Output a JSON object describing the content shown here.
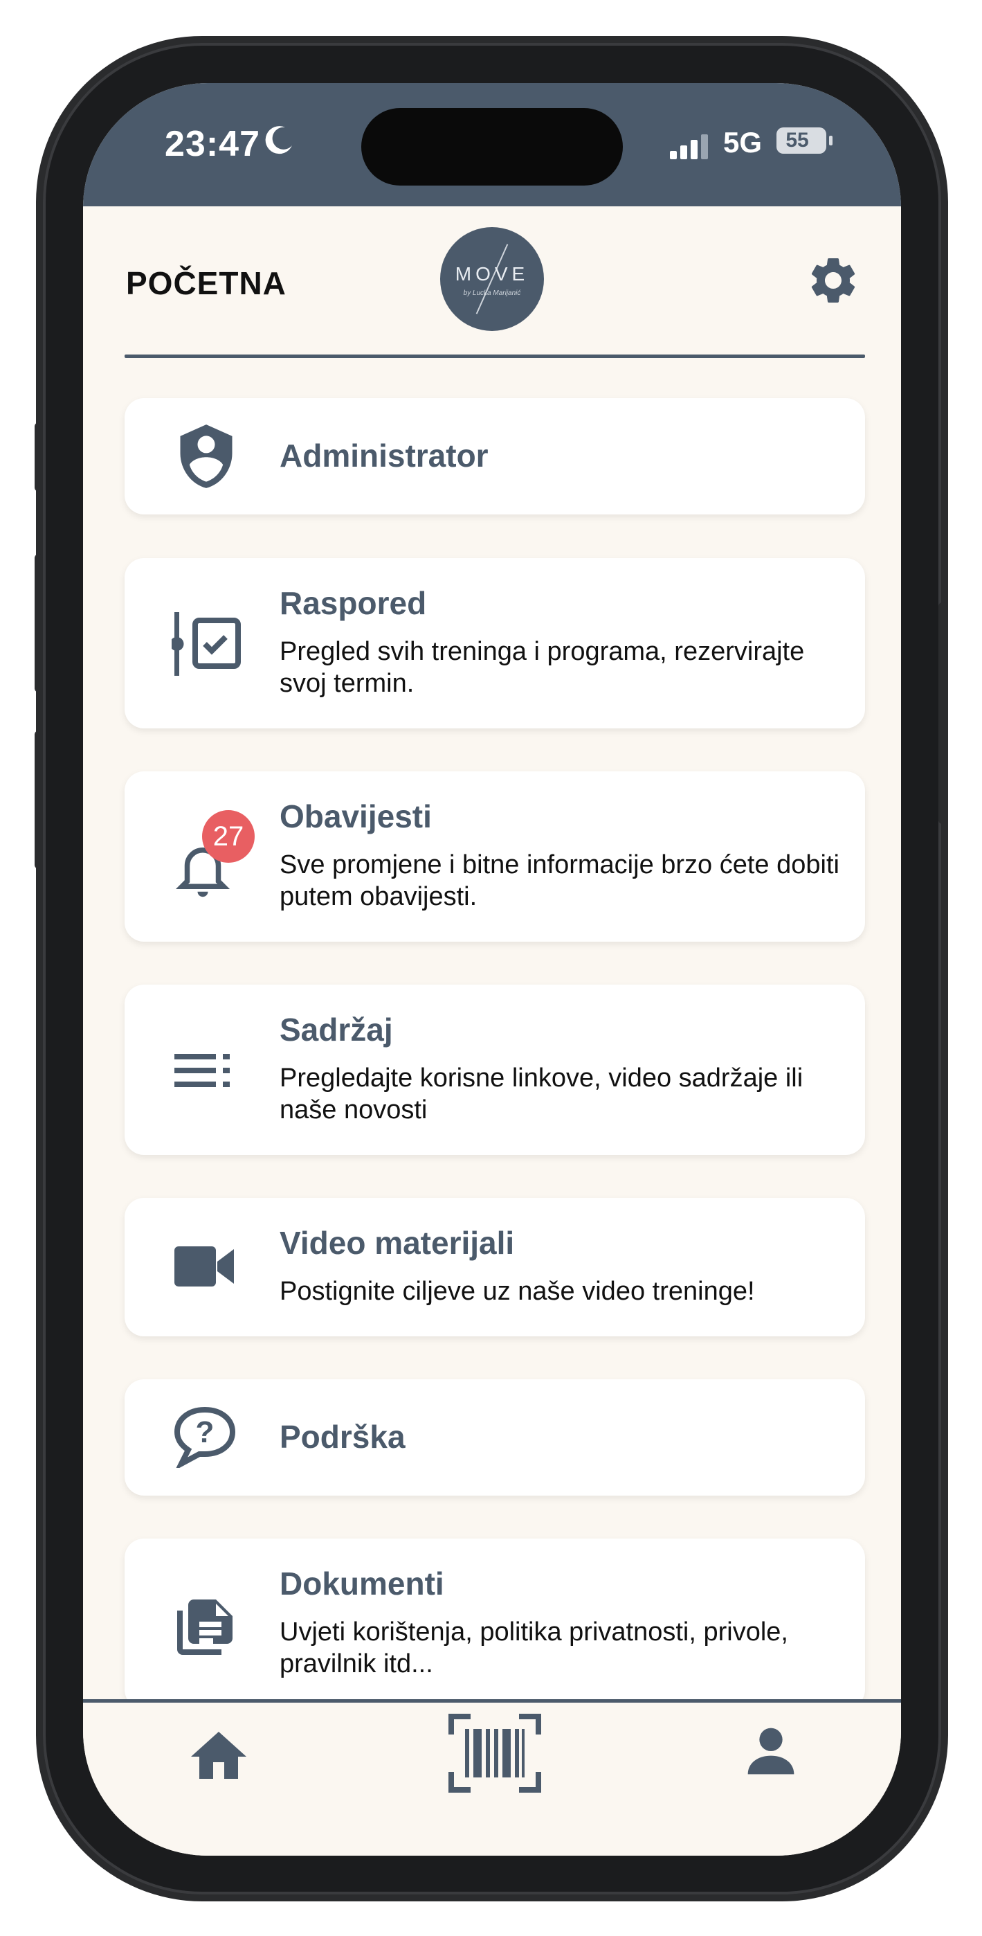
{
  "status": {
    "time": "23:47",
    "network": "5G",
    "battery": "55"
  },
  "header": {
    "title": "POČETNA",
    "logo_text": "MOVE",
    "logo_sub": "by Lucka Marijanić"
  },
  "cards": [
    {
      "icon": "admin-shield-icon",
      "title": "Administrator",
      "desc": ""
    },
    {
      "icon": "schedule-icon",
      "title": "Raspored",
      "desc": "Pregled svih treninga i programa, rezervirajte svoj termin."
    },
    {
      "icon": "bell-icon",
      "title": "Obavijesti",
      "desc": "Sve promjene i bitne informacije brzo ćete dobiti putem obavijesti.",
      "badge": "27"
    },
    {
      "icon": "list-icon",
      "title": "Sadržaj",
      "desc": "Pregledajte korisne linkove, video sadržaje ili naše novosti"
    },
    {
      "icon": "video-camera-icon",
      "title": "Video materijali",
      "desc": "Postignite ciljeve uz naše video treninge!"
    },
    {
      "icon": "help-chat-icon",
      "title": "Podrška",
      "desc": ""
    },
    {
      "icon": "document-icon",
      "title": "Dokumenti",
      "desc": "Uvjeti korištenja, politika privatnosti, privole, pravilnik itd..."
    }
  ],
  "bottom_nav": {
    "items": [
      "home-icon",
      "barcode-scan-icon",
      "user-icon"
    ]
  },
  "colors": {
    "primary": "#4b5a6b",
    "background": "#fbf7f1",
    "badge": "#e85f62"
  }
}
